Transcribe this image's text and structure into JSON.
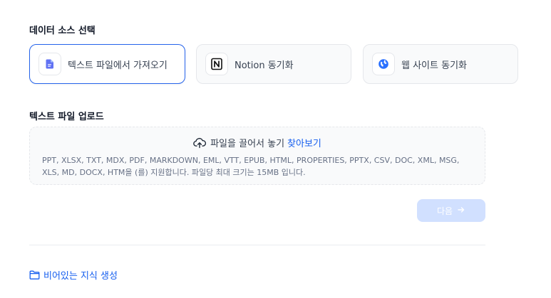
{
  "data_source": {
    "title": "데이터 소스 선택",
    "options": [
      {
        "label": "텍스트 파일에서 가져오기",
        "icon": "file-text-icon",
        "selected": true
      },
      {
        "label": "Notion 동기화",
        "icon": "notion-icon",
        "selected": false
      },
      {
        "label": "웹 사이트 동기화",
        "icon": "web-globe-icon",
        "selected": false
      }
    ]
  },
  "upload": {
    "title": "텍스트 파일 업로드",
    "drop_text": "파일을 끌어서 놓기",
    "browse_text": "찾아보기",
    "tip": "PPT, XLSX, TXT, MDX, PDF, MARKDOWN, EML, VTT, EPUB, HTML, PROPERTIES, PPTX, CSV, DOC, XML, MSG, XLS, MD, DOCX, HTM을 (를) 지원합니다. 파일당 최대 크기는 15MB 입니다."
  },
  "next_button": {
    "label": "다음",
    "disabled": true
  },
  "empty_kb": {
    "label": "비어있는 지식 생성",
    "icon": "folder-icon"
  },
  "colors": {
    "accent": "#155eef",
    "selected_border": "#2563eb",
    "disabled_button": "#d1e0ff"
  }
}
